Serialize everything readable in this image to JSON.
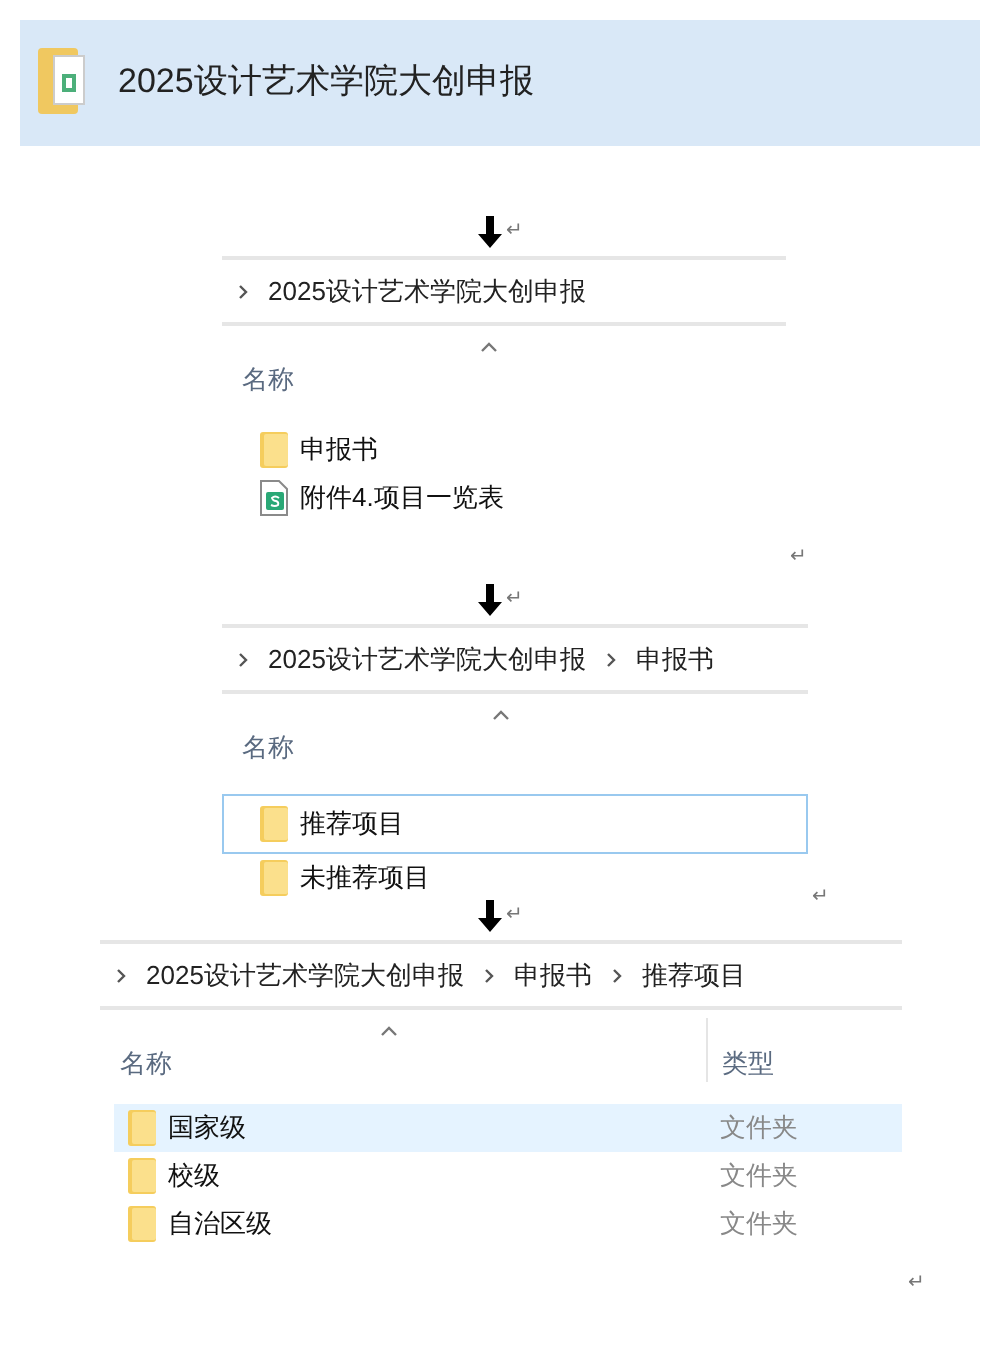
{
  "header": {
    "title": "2025设计艺术学院大创申报"
  },
  "steps": [
    {
      "arrow_mark": "↵",
      "panel": {
        "breadcrumb": [
          "2025设计艺术学院大创申报"
        ],
        "columns": [
          {
            "label": "名称"
          }
        ],
        "items": [
          {
            "kind": "folder",
            "name": "申报书",
            "selected": false,
            "focused": false
          },
          {
            "kind": "sheet",
            "name": "附件4.项目一览表",
            "selected": false,
            "focused": false
          }
        ]
      },
      "end_mark": "↵"
    },
    {
      "arrow_mark": "↵",
      "panel": {
        "breadcrumb": [
          "2025设计艺术学院大创申报",
          "申报书"
        ],
        "columns": [
          {
            "label": "名称"
          }
        ],
        "items": [
          {
            "kind": "folder",
            "name": "推荐项目",
            "selected": false,
            "focused": true
          },
          {
            "kind": "folder",
            "name": "未推荐项目",
            "selected": false,
            "focused": false
          }
        ]
      },
      "end_mark": "↵"
    },
    {
      "arrow_mark": "↵",
      "panel": {
        "breadcrumb": [
          "2025设计艺术学院大创申报",
          "申报书",
          "推荐项目"
        ],
        "columns": [
          {
            "label": "名称"
          },
          {
            "label": "类型"
          }
        ],
        "items": [
          {
            "kind": "folder",
            "name": "国家级",
            "type": "文件夹",
            "selected": true,
            "focused": false
          },
          {
            "kind": "folder",
            "name": "校级",
            "type": "文件夹",
            "selected": false,
            "focused": false
          },
          {
            "kind": "folder",
            "name": "自治区级",
            "type": "文件夹",
            "selected": false,
            "focused": false
          }
        ]
      },
      "end_mark": "↵"
    }
  ]
}
